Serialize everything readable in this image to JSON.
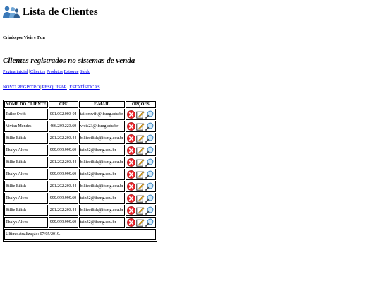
{
  "header": {
    "logo_icon": "users-icon",
    "title": "Lista de Clientes",
    "author": "Criado por Vivis e Tzin"
  },
  "section_title": "Clientes registrados no sistemas de venda",
  "nav": [
    {
      "label": "Pagina inicial",
      "sep": "|"
    },
    {
      "label": "Clientes",
      "sep": ""
    },
    {
      "label": "Produtos",
      "sep": ""
    },
    {
      "label": "Estoque",
      "sep": ""
    },
    {
      "label": "Saldo",
      "sep": ""
    }
  ],
  "actions": [
    {
      "label": "NOVO REGISTRO",
      "sep": "|"
    },
    {
      "label": "PESQUISAR",
      "sep": "|"
    },
    {
      "label": "ESTATÍSTICAS",
      "sep": ""
    }
  ],
  "table": {
    "headers": [
      "NOME DO CLIENTE",
      "CPF",
      "E-MAIL",
      "OPÇÕES"
    ],
    "rows": [
      [
        "Tailor Swift",
        "001.002.003-04",
        "tailorswift@ifsmg.edu.br"
      ],
      [
        "Vivian Mendes",
        "466.289.223.69",
        "vivis23@ifsmg.edu.br"
      ],
      [
        "Billie Eilish",
        "201.202.203.44",
        "billieeilish@ifsmg.edu.br"
      ],
      [
        "Thalys Alves",
        "999.999.999.69",
        "tzin32@ifsmg.edu.br"
      ],
      [
        "Billie Eilish",
        "201.202.203.44",
        "billieeilish@ifsmg.edu.br"
      ],
      [
        "Thalys Alves",
        "999.999.999.69",
        "tzin32@ifsmg.edu.br"
      ],
      [
        "Billie Eilish",
        "201.202.203.44",
        "billieeilish@ifsmg.edu.br"
      ],
      [
        "Thalys Alves",
        "999.999.999.69",
        "tzin32@ifsmg.edu.br"
      ],
      [
        "Billie Eilish",
        "201.202.203.44",
        "billieeilish@ifsmg.edu.br"
      ],
      [
        "Thalys Alves",
        "999.999.999.69",
        "tzin32@ifsmg.edu.br"
      ]
    ],
    "option_icons": [
      "delete-icon",
      "edit-icon",
      "search-icon"
    ],
    "footer": "Ultimo atualização: 07/05/2019."
  },
  "colors": {
    "link": "#0000ee",
    "delete": "#e8232a",
    "edit_frame": "#1a1a1a",
    "pencil": "#f0b429",
    "magnifier": "#4a90c8"
  }
}
